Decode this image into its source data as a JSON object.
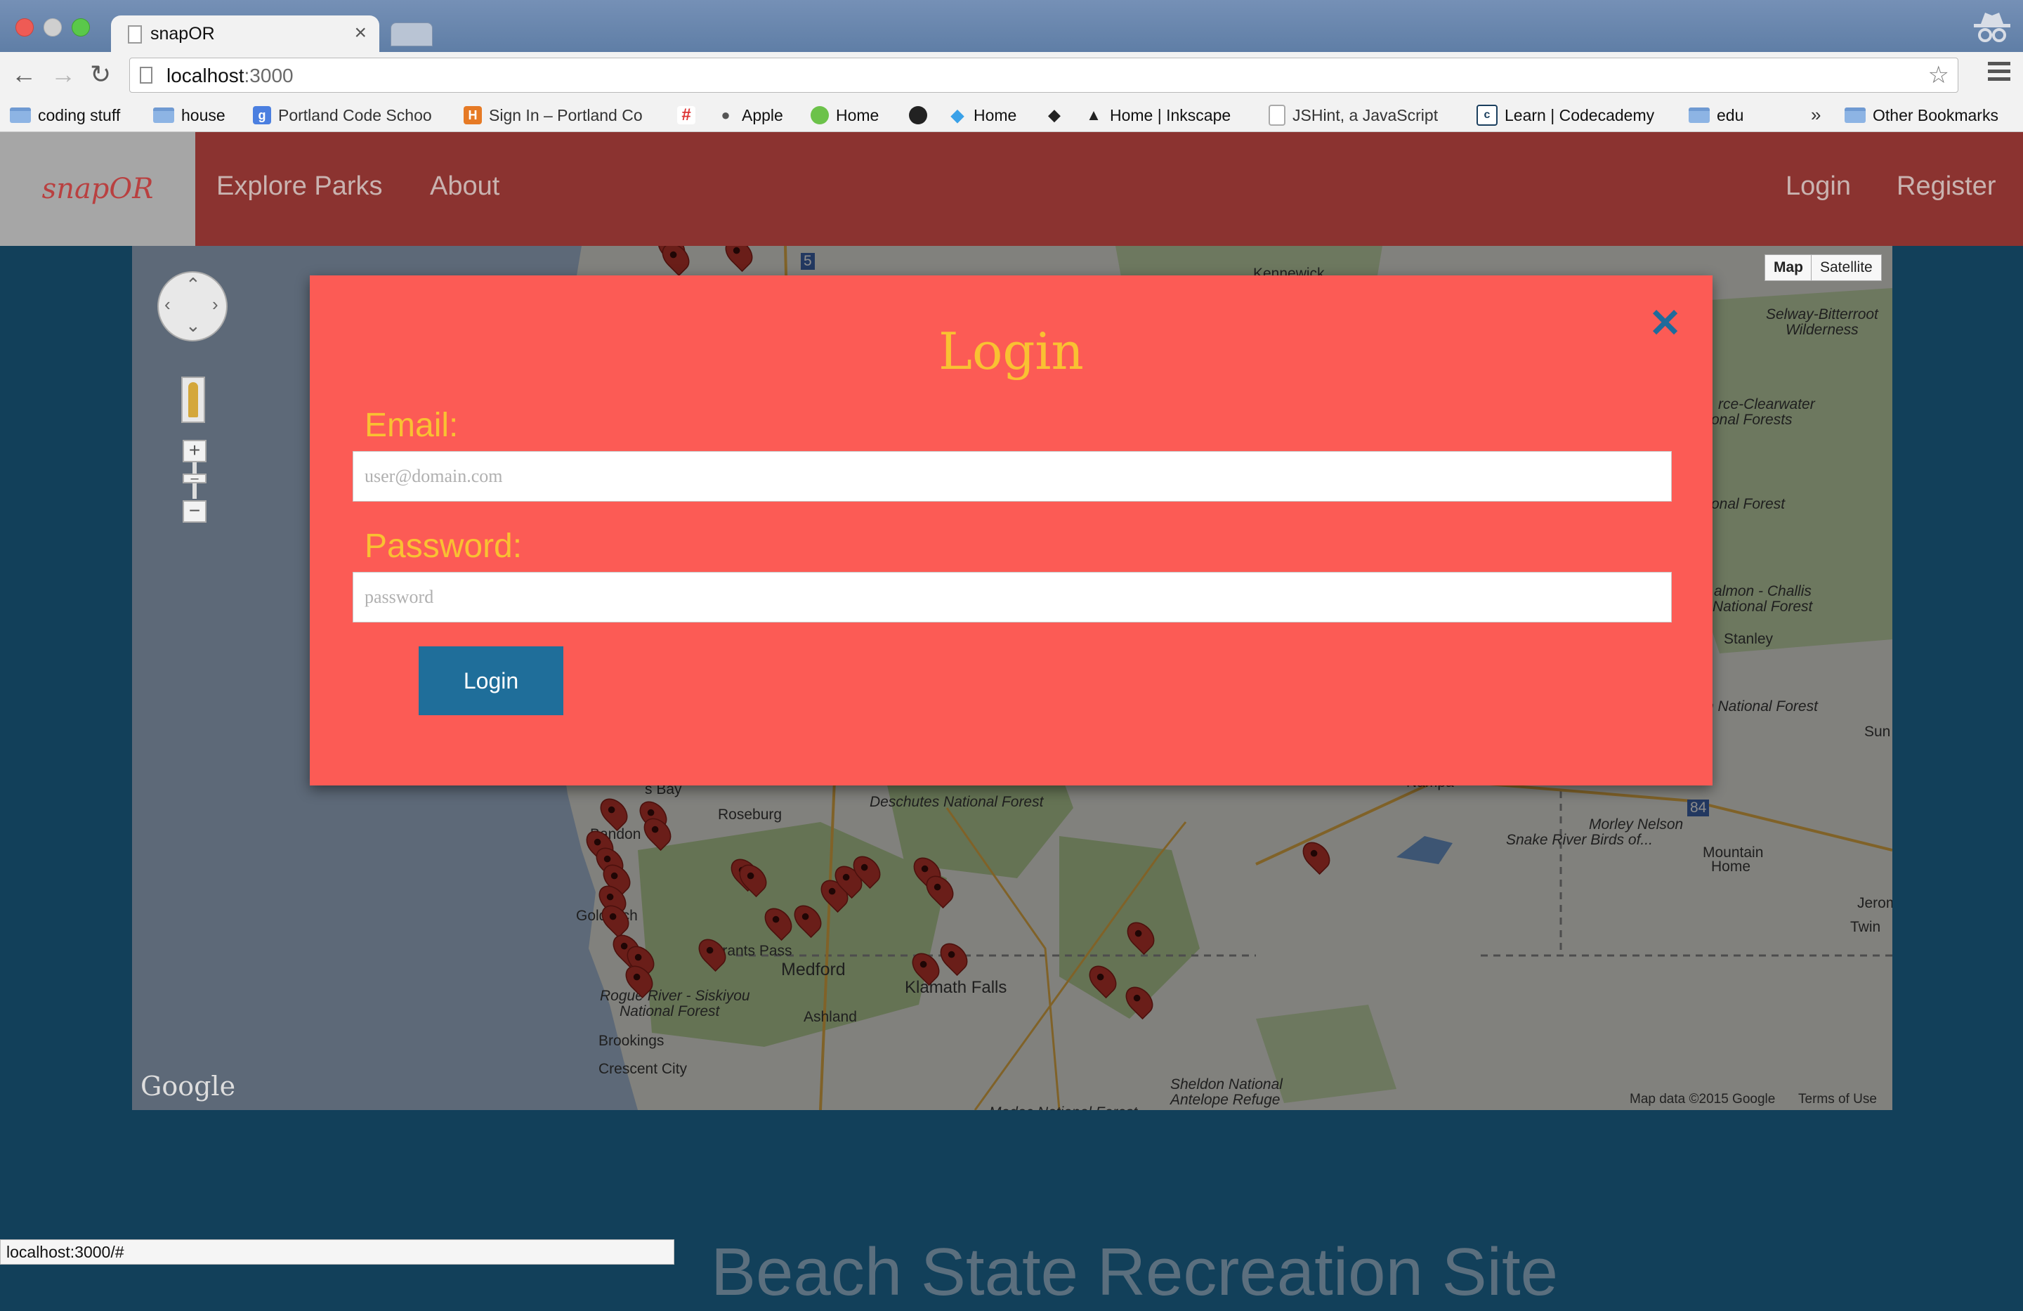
{
  "browser": {
    "tab_title": "snapOR",
    "url_host": "localhost",
    "url_port": ":3000",
    "bookmarks": [
      {
        "label": "coding stuff",
        "icon": "folder-icon"
      },
      {
        "label": "house",
        "icon": "folder-icon"
      },
      {
        "label": "Portland Code Schoo",
        "icon": "google-icon"
      },
      {
        "label": "Sign In – Portland Co",
        "icon": "h-icon"
      },
      {
        "label": "",
        "icon": "slack-icon"
      },
      {
        "label": "Apple",
        "icon": "apple-icon"
      },
      {
        "label": "Home",
        "icon": "meteor-icon"
      },
      {
        "label": "",
        "icon": "github-icon"
      },
      {
        "label": "Home",
        "icon": "twitter-icon"
      },
      {
        "label": "",
        "icon": "diamond-icon"
      },
      {
        "label": "Home | Inkscape",
        "icon": "inkscape-icon"
      },
      {
        "label": "JSHint, a JavaScript",
        "icon": "page-icon"
      },
      {
        "label": "Learn | Codecademy",
        "icon": "codecademy-icon"
      },
      {
        "label": "edu",
        "icon": "folder-icon"
      },
      {
        "label": "Other Bookmarks",
        "icon": "folder-icon"
      }
    ],
    "overflow_chevron": "»",
    "status_url": "localhost:3000/#"
  },
  "site": {
    "brand": "snapOR",
    "nav": {
      "explore": "Explore Parks",
      "about": "About",
      "login": "Login",
      "register": "Register"
    }
  },
  "map": {
    "type_map": "Map",
    "type_satellite": "Satellite",
    "google": "Google",
    "attribution": "Map data ©2015 Google",
    "terms": "Terms of Use",
    "labels": {
      "selway": "Selway-Bitterroot",
      "wilderness": "Wilderness",
      "clearwater": "rce-Clearwater",
      "clearwater_forests": "onal Forests",
      "onal_forest": "onal Forest",
      "salmon": "almon - Challis",
      "salmon_forest": "National Forest",
      "stanley": "Stanley",
      "n_forest": "n National Forest",
      "sun": "Sun",
      "morley": "Morley Nelson",
      "snake": "Snake River Birds of...",
      "mountain": "Mountain",
      "mountain_home": "Home",
      "jerome": "Jerom",
      "twin": "Twin",
      "nampa": "Nampa",
      "deschutes": "Deschutes National Forest",
      "roseburg": "Roseburg",
      "coos_bay": "s Bay",
      "bandon": "Bandon",
      "gold_beach": "Gold",
      "beach": "ach",
      "grants_pass": "Grants Pass",
      "medford": "Medford",
      "ashland": "Ashland",
      "klamath": "Klamath Falls",
      "rogue": "Rogue River - Siskiyou",
      "rogue_forest": "National Forest",
      "brookings": "Brookings",
      "crescent": "Crescent City",
      "sheldon": "Sheldon National",
      "antelope": "Antelope Refuge",
      "modoc": "Modoc National Forest",
      "kennewick": "Kennewick",
      "i5": "5",
      "i84": "84"
    }
  },
  "modal": {
    "title": "Login",
    "close": "✕",
    "email_label": "Email:",
    "email_placeholder": "user@domain.com",
    "password_label": "Password:",
    "password_placeholder": "password",
    "submit": "Login"
  },
  "section_title": "Beach State Recreation Site"
}
